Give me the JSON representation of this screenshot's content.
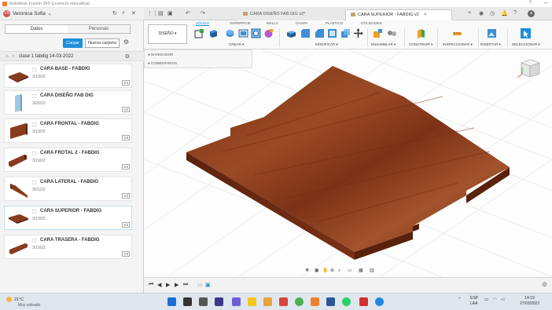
{
  "window": {
    "title": "Autodesk Fusion 360 (Licencia educativa)",
    "help_icon": "help-icon",
    "minimize_icon": "minimize-icon"
  },
  "user": {
    "initials": "VS",
    "name": "Veronica Sofia"
  },
  "doc_tabs": [
    {
      "label": "CARA DISEÑO FAB DIG v2*",
      "active": false
    },
    {
      "label": "CARA SUPERIOR - FABDIG v2",
      "active": true
    }
  ],
  "left_panel": {
    "tabs": [
      "Datos",
      "Personas"
    ],
    "upload_label": "Cargar",
    "new_folder_label": "Nueva carpeta",
    "breadcrumb": "clase 1 fabdig 14-03-2022",
    "files": [
      {
        "name": "CARA BASE - FABDIG",
        "date": "3/19/22",
        "version": "V3"
      },
      {
        "name": "CARA DISEÑO FAB DIG",
        "date": "3/26/22",
        "version": "V3"
      },
      {
        "name": "CARA FRONTAL - FABDIG",
        "date": "3/19/22",
        "version": "V3"
      },
      {
        "name": "CARA FROTAL 2 - FABDIG",
        "date": "3/19/22",
        "version": "V3"
      },
      {
        "name": "CARA LATERAL - FABDIG",
        "date": "3/21/22",
        "version": "V3"
      },
      {
        "name": "CARA SUPERIOR - FABDIG",
        "date": "3/19/22",
        "version": "V2"
      },
      {
        "name": "CARA TRASERA - FABDIG",
        "date": "3/19/22",
        "version": "V3"
      }
    ]
  },
  "toolbar": {
    "design_label": "DISEÑO ▾",
    "workspace_tabs": [
      "SÓLIDO",
      "SUPERFICIE",
      "MALLA",
      "CHAPA",
      "PLÁSTICO",
      "UTILIDADES"
    ],
    "groups": [
      "CREAR ▾",
      "MODIFICAR ▾",
      "ENSAMBLAR ▾",
      "CONSTRUIR ▾",
      "INSPECCIONAR ▾",
      "INSERTAR ▾",
      "SELECCIONAR ▾"
    ]
  },
  "browser": {
    "items": [
      "NAVEGADOR",
      "COMENTARIOS"
    ]
  },
  "taskbar": {
    "temperature": "21°C",
    "weather": "Muy soleado",
    "language": "ESP",
    "layout": "LAA",
    "time": "14:19",
    "date": "27/03/2022"
  },
  "colors": {
    "accent": "#1e8ed8",
    "wood": "#8b3a1c"
  }
}
